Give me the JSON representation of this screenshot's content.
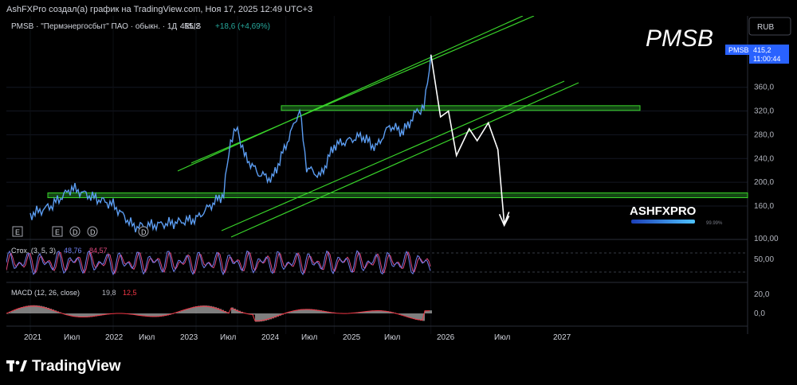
{
  "header": {
    "credit": "AshFXPro создал(а) график на TradingView.com, Ноя 17, 2025 12:49 UTC+3"
  },
  "symbol_bar": {
    "symbol": "PMSB · \"Пермэнергосбыт\" ПАО · обыкн. · 1Д · RUS",
    "price": "415,2",
    "change": "+18,6 (+4,69%)"
  },
  "watermark": "PMSB",
  "currency": "RUB",
  "price_tag": {
    "symbol": "PMSB",
    "price": "415,2",
    "countdown": "11:00:44"
  },
  "brand_overlay": {
    "name": "ASHFXPRO",
    "percent": "99.99%"
  },
  "event_markers": [
    "E",
    "E",
    "D",
    "D",
    "D"
  ],
  "stoch": {
    "label": "Стох. (3, 5, 3)",
    "k": "48,76",
    "d": "84,57",
    "ticks": [
      "100,00",
      "50,00"
    ]
  },
  "macd": {
    "label": "MACD (12, 26, close)",
    "macd": "19,8",
    "signal": "12,5",
    "ticks": [
      "20,0",
      "0,0"
    ]
  },
  "x_axis_labels": [
    "2021",
    "Июл",
    "2022",
    "Июл",
    "2023",
    "Июл",
    "2024",
    "Июл",
    "2025",
    "Июл",
    "2026",
    "Июл",
    "2027"
  ],
  "footer": {
    "brand": "TradingView"
  },
  "colors": {
    "price_line": "#5b9cf0",
    "channel": "#39d32a",
    "zone_fill": "#1b5e1b",
    "projection": "#ffffff",
    "stoch_k": "#6f7ff0",
    "stoch_d": "#e0487e",
    "macd_hist": "#b4b4b4",
    "macd_line": "#f23645"
  },
  "chart_data": {
    "type": "line",
    "title": "PMSB",
    "y_ticks": [
      "360,0",
      "320,0",
      "280,0",
      "240,0",
      "200,0",
      "160,0"
    ],
    "ylim": [
      105,
      440
    ],
    "x": [
      "2021-01",
      "2021-04",
      "2021-07",
      "2021-10",
      "2022-01",
      "2022-04",
      "2022-07",
      "2022-10",
      "2023-01",
      "2023-03",
      "2023-05",
      "2023-06",
      "2023-07",
      "2023-08",
      "2023-10",
      "2023-12",
      "2024-02",
      "2024-04",
      "2024-05",
      "2024-07",
      "2024-09",
      "2024-11",
      "2025-01",
      "2025-03",
      "2025-05",
      "2025-07",
      "2025-09",
      "2025-10",
      "2025-11"
    ],
    "series": [
      {
        "name": "PMSB",
        "values": [
          145,
          160,
          190,
          175,
          162,
          125,
          128,
          132,
          138,
          160,
          180,
          272,
          290,
          245,
          215,
          205,
          262,
          322,
          225,
          210,
          262,
          270,
          278,
          258,
          295,
          285,
          320,
          325,
          415
        ]
      }
    ],
    "levels": [
      325,
      178
    ],
    "projection": [
      [
        0,
        415
      ],
      [
        6,
        310
      ],
      [
        11,
        320
      ],
      [
        16,
        245
      ],
      [
        24,
        290
      ],
      [
        29,
        270
      ],
      [
        36,
        300
      ],
      [
        42,
        255
      ],
      [
        46,
        130
      ],
      [
        49,
        150
      ]
    ]
  }
}
